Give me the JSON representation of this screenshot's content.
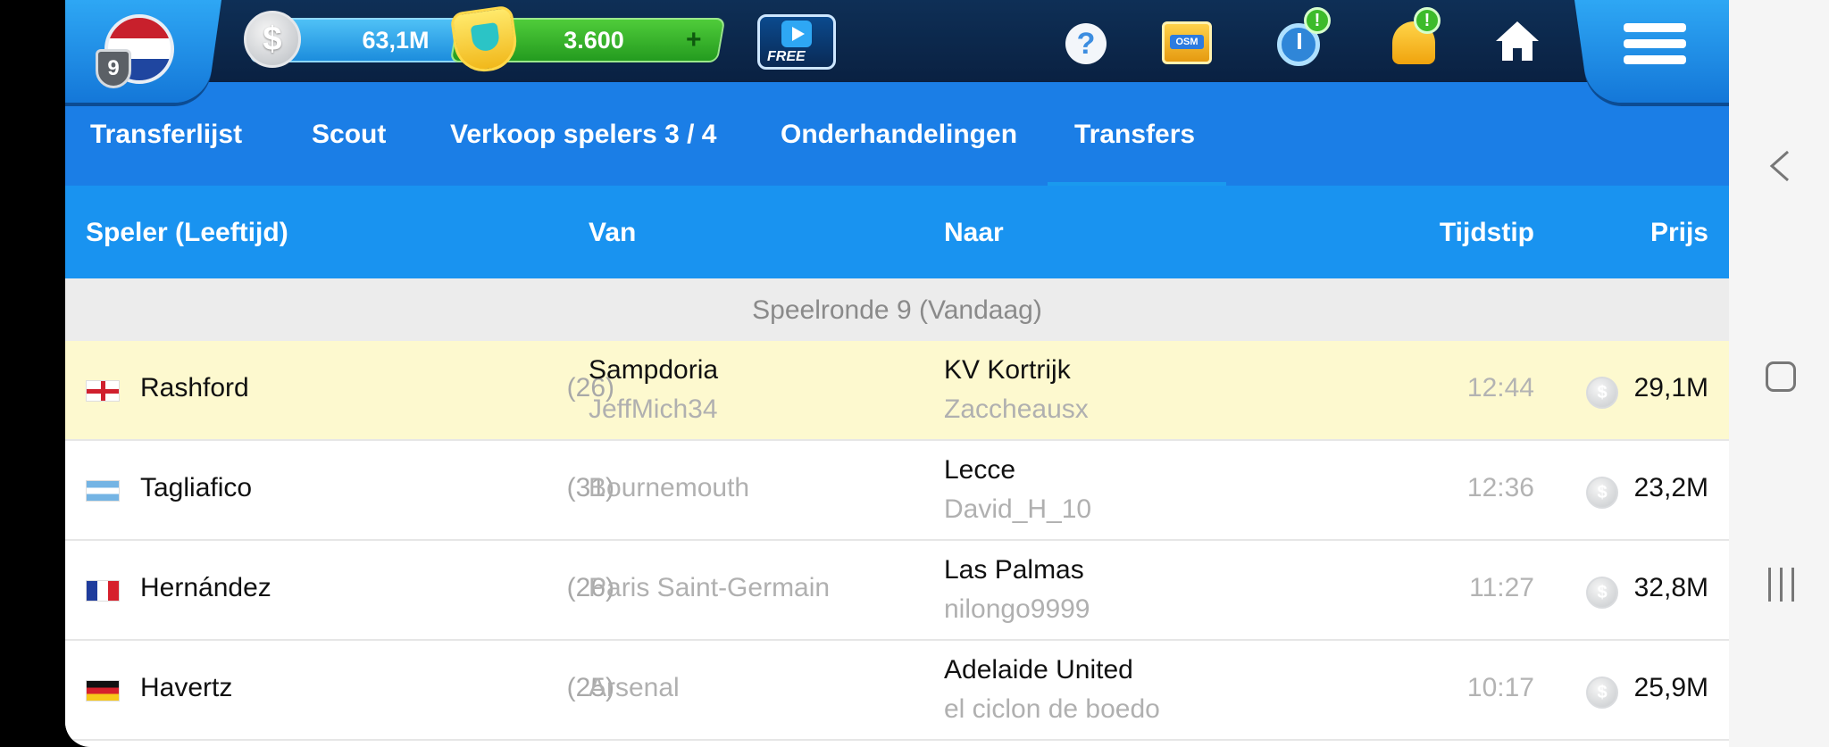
{
  "topbar": {
    "level": "9",
    "money": "63,1M",
    "coins": "3.600",
    "free_label": "FREE",
    "shop_label": "OSM",
    "help_symbol": "?",
    "alert_symbol": "!",
    "coin_symbol": "$",
    "plus_symbol": "+",
    "country_flag": "netherlands-flag",
    "icons": [
      "help-icon",
      "shop-icon",
      "timer-icon",
      "bell-icon",
      "home-icon",
      "menu-icon"
    ]
  },
  "tabs": [
    {
      "label": "Transferlijst"
    },
    {
      "label": "Scout"
    },
    {
      "label": "Verkoop spelers 3 / 4"
    },
    {
      "label": "Onderhandelingen"
    },
    {
      "label": "Transfers",
      "active": true
    }
  ],
  "table": {
    "headers": {
      "player": "Speler (Leeftijd)",
      "from": "Van",
      "to": "Naar",
      "time": "Tijdstip",
      "price": "Prijs"
    },
    "group_label": "Speelronde 9 (Vandaag)",
    "rows": [
      {
        "flag": "england",
        "name": "Rashford",
        "age": "(26)",
        "from_club": "Sampdoria",
        "from_manager": "JeffMich34",
        "to_club": "KV Kortrijk",
        "to_manager": "Zaccheausx",
        "time": "12:44",
        "price": "29,1M",
        "highlight": true
      },
      {
        "flag": "argentina",
        "name": "Tagliafico",
        "age": "(31)",
        "from_club": "Bournemouth",
        "from_manager": "",
        "to_club": "Lecce",
        "to_manager": "David_H_10",
        "time": "12:36",
        "price": "23,2M"
      },
      {
        "flag": "france",
        "name": "Hernández",
        "age": "(26)",
        "from_club": "Paris Saint-Germain",
        "from_manager": "",
        "to_club": "Las Palmas",
        "to_manager": "nilongo9999",
        "time": "11:27",
        "price": "32,8M"
      },
      {
        "flag": "germany",
        "name": "Havertz",
        "age": "(25)",
        "from_club": "Arsenal",
        "from_manager": "",
        "to_club": "Adelaide United",
        "to_manager": "el ciclon de boedo",
        "time": "10:17",
        "price": "25,9M"
      }
    ]
  },
  "colors": {
    "topbar": "#0a2142",
    "tabs": "#1b7ee6",
    "header": "#1993f0",
    "highlight_row": "#fdf9cf"
  }
}
